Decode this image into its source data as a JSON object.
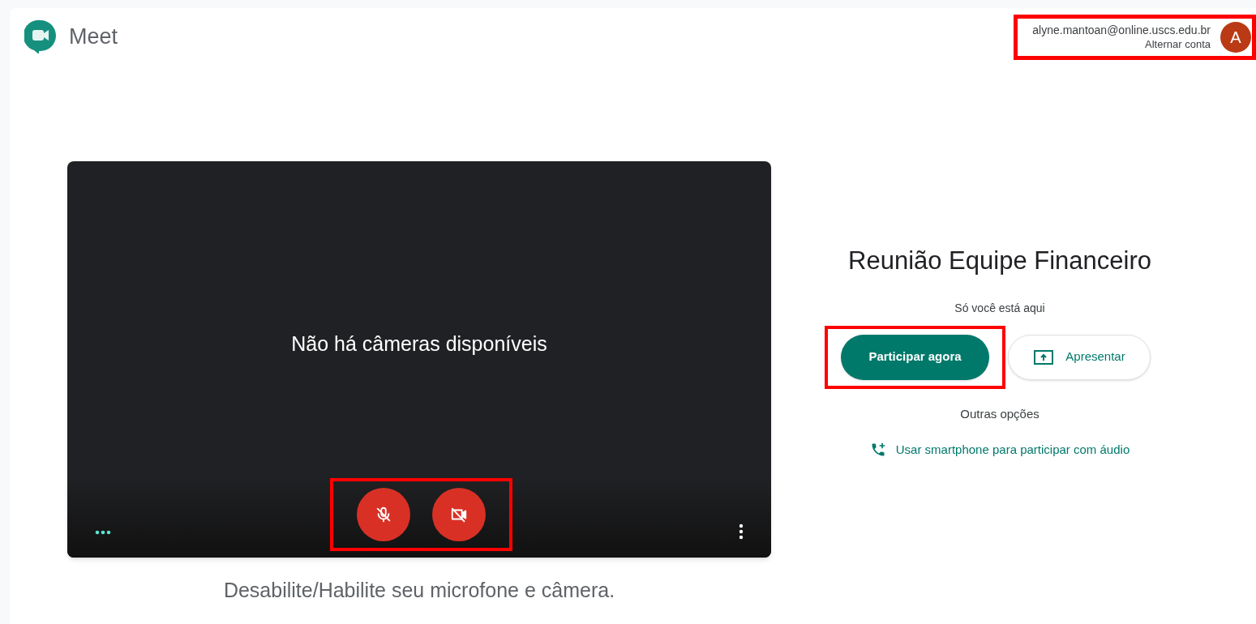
{
  "header": {
    "app_name": "Meet",
    "account": {
      "email": "alyne.mantoan@online.uscs.edu.br",
      "switch_label": "Alternar conta",
      "avatar_letter": "A",
      "color": "#b93a14"
    }
  },
  "preview": {
    "message": "Não há câmeras disponíveis",
    "controls": [
      {
        "kind": "microphone",
        "on": false
      },
      {
        "kind": "camera",
        "on": false
      }
    ],
    "caption": "Desabilite/Habilite seu microfone e câmera."
  },
  "meeting": {
    "title": "Reunião Equipe Financeiro",
    "status": "Só você está aqui",
    "join_button": "Participar agora",
    "present_button": "Apresentar",
    "other_options": "Outras opções",
    "phone_link": "Usar smartphone para participar com áudio"
  }
}
